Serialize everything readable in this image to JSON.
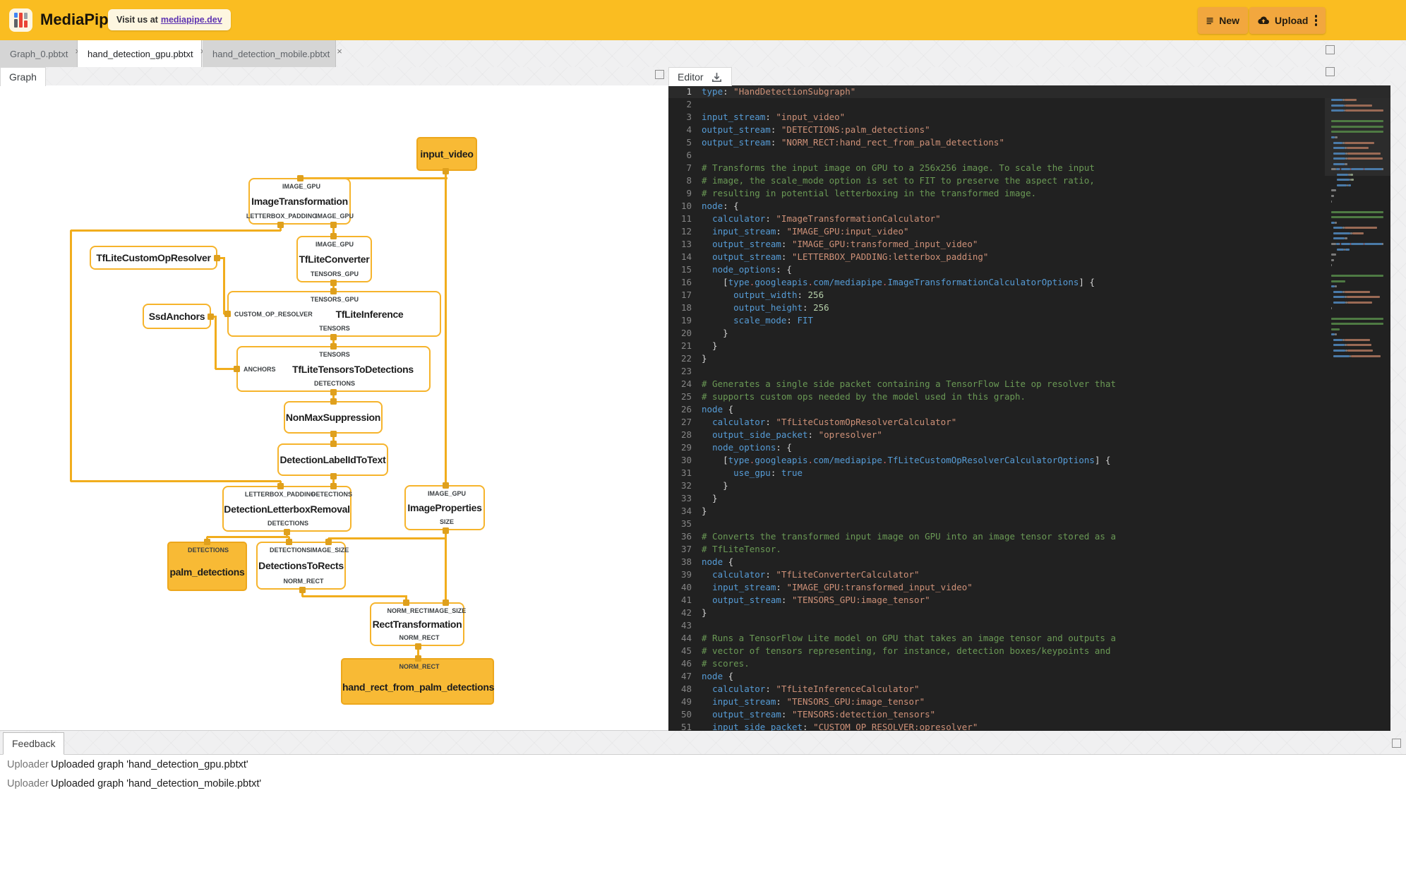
{
  "header": {
    "brand": "MediaPipe",
    "visit_prefix": "Visit us at",
    "visit_link": "mediapipe.dev",
    "new_label": "New",
    "upload_label": "Upload"
  },
  "colors": {
    "header_bg": "#fabd21",
    "header_button_bg": "#f2a73e",
    "edge": "#f1ad1d",
    "node_border": "#f6b42c",
    "stream_fill": "#f8ba35",
    "editor_bg": "#212121",
    "link": "#5e35b1"
  },
  "file_tabs": [
    {
      "label": "Graph_0.pbtxt",
      "active": false,
      "close": "×"
    },
    {
      "label": "hand_detection_gpu.pbtxt",
      "active": true,
      "close": "×"
    },
    {
      "label": "hand_detection_mobile.pbtxt",
      "active": false,
      "close": "×"
    }
  ],
  "panel_tabs": {
    "graph": "Graph",
    "editor": "Editor",
    "feedback": "Feedback"
  },
  "graph": {
    "nodes": [
      {
        "id": "input_video",
        "label": "input_video",
        "kind": "stream",
        "top_ports": [],
        "bottom_ports": [],
        "left_port": null
      },
      {
        "id": "ImageTransformation",
        "label": "ImageTransformation",
        "kind": "calc",
        "top_ports": [
          "IMAGE_GPU"
        ],
        "bottom_ports": [
          "LETTERBOX_PADDING",
          "IMAGE_GPU"
        ],
        "left_port": null
      },
      {
        "id": "TfLiteConverter",
        "label": "TfLiteConverter",
        "kind": "calc",
        "top_ports": [
          "IMAGE_GPU"
        ],
        "bottom_ports": [
          "TENSORS_GPU"
        ],
        "left_port": null
      },
      {
        "id": "TfLiteCustomOpResolver",
        "label": "TfLiteCustomOpResolver",
        "kind": "calc",
        "top_ports": [],
        "bottom_ports": [],
        "left_port": null
      },
      {
        "id": "SsdAnchors",
        "label": "SsdAnchors",
        "kind": "calc",
        "top_ports": [],
        "bottom_ports": [],
        "left_port": null
      },
      {
        "id": "TfLiteInference",
        "label": "TfLiteInference",
        "kind": "calc",
        "top_ports": [
          "TENSORS_GPU"
        ],
        "bottom_ports": [
          "TENSORS"
        ],
        "left_port": "CUSTOM_OP_RESOLVER"
      },
      {
        "id": "TfLiteTensorsToDetections",
        "label": "TfLiteTensorsToDetections",
        "kind": "calc",
        "top_ports": [
          "TENSORS"
        ],
        "bottom_ports": [
          "DETECTIONS"
        ],
        "left_port": "ANCHORS"
      },
      {
        "id": "NonMaxSuppression",
        "label": "NonMaxSuppression",
        "kind": "calc",
        "top_ports": [],
        "bottom_ports": [],
        "left_port": null
      },
      {
        "id": "DetectionLabelIdToText",
        "label": "DetectionLabelIdToText",
        "kind": "calc",
        "top_ports": [],
        "bottom_ports": [],
        "left_port": null
      },
      {
        "id": "DetectionLetterboxRemoval",
        "label": "DetectionLetterboxRemoval",
        "kind": "calc",
        "top_ports": [
          "LETTERBOX_PADDING",
          "DETECTIONS"
        ],
        "bottom_ports": [
          "DETECTIONS"
        ],
        "left_port": null
      },
      {
        "id": "ImageProperties",
        "label": "ImageProperties",
        "kind": "calc",
        "top_ports": [
          "IMAGE_GPU"
        ],
        "bottom_ports": [
          "SIZE"
        ],
        "left_port": null
      },
      {
        "id": "palm_detections",
        "label": "palm_detections",
        "kind": "stream",
        "top_ports": [
          "DETECTIONS"
        ],
        "bottom_ports": [],
        "left_port": null
      },
      {
        "id": "DetectionsToRects",
        "label": "DetectionsToRects",
        "kind": "calc",
        "top_ports": [
          "DETECTIONS",
          "IMAGE_SIZE"
        ],
        "bottom_ports": [
          "NORM_RECT"
        ],
        "left_port": null
      },
      {
        "id": "RectTransformation",
        "label": "RectTransformation",
        "kind": "calc",
        "top_ports": [
          "NORM_RECT",
          "IMAGE_SIZE"
        ],
        "bottom_ports": [
          "NORM_RECT"
        ],
        "left_port": null
      },
      {
        "id": "hand_rect_from_palm_detections",
        "label": "hand_rect_from_palm_detections",
        "kind": "stream",
        "top_ports": [
          "NORM_RECT"
        ],
        "bottom_ports": [],
        "left_port": null
      }
    ]
  },
  "editor": {
    "lines": [
      {
        "n": 1,
        "t": [
          [
            "k",
            "type"
          ],
          [
            "p",
            ": "
          ],
          [
            "s",
            "\"HandDetectionSubgraph\""
          ]
        ]
      },
      {
        "n": 2,
        "t": []
      },
      {
        "n": 3,
        "t": [
          [
            "k",
            "input_stream"
          ],
          [
            "p",
            ": "
          ],
          [
            "s",
            "\"input_video\""
          ]
        ]
      },
      {
        "n": 4,
        "t": [
          [
            "k",
            "output_stream"
          ],
          [
            "p",
            ": "
          ],
          [
            "s",
            "\"DETECTIONS:palm_detections\""
          ]
        ]
      },
      {
        "n": 5,
        "t": [
          [
            "k",
            "output_stream"
          ],
          [
            "p",
            ": "
          ],
          [
            "s",
            "\"NORM_RECT:hand_rect_from_palm_detections\""
          ]
        ]
      },
      {
        "n": 6,
        "t": []
      },
      {
        "n": 7,
        "t": [
          [
            "c",
            "# Transforms the input image on GPU to a 256x256 image. To scale the input"
          ]
        ]
      },
      {
        "n": 8,
        "t": [
          [
            "c",
            "# image, the scale_mode option is set to FIT to preserve the aspect ratio,"
          ]
        ]
      },
      {
        "n": 9,
        "t": [
          [
            "c",
            "# resulting in potential letterboxing in the transformed image."
          ]
        ]
      },
      {
        "n": 10,
        "t": [
          [
            "k",
            "node"
          ],
          [
            "p",
            ": {"
          ]
        ]
      },
      {
        "n": 11,
        "t": [
          [
            "p",
            "  "
          ],
          [
            "k",
            "calculator"
          ],
          [
            "p",
            ": "
          ],
          [
            "s",
            "\"ImageTransformationCalculator\""
          ]
        ]
      },
      {
        "n": 12,
        "t": [
          [
            "p",
            "  "
          ],
          [
            "k",
            "input_stream"
          ],
          [
            "p",
            ": "
          ],
          [
            "s",
            "\"IMAGE_GPU:input_video\""
          ]
        ]
      },
      {
        "n": 13,
        "t": [
          [
            "p",
            "  "
          ],
          [
            "k",
            "output_stream"
          ],
          [
            "p",
            ": "
          ],
          [
            "s",
            "\"IMAGE_GPU:transformed_input_video\""
          ]
        ]
      },
      {
        "n": 14,
        "t": [
          [
            "p",
            "  "
          ],
          [
            "k",
            "output_stream"
          ],
          [
            "p",
            ": "
          ],
          [
            "s",
            "\"LETTERBOX_PADDING:letterbox_padding\""
          ]
        ]
      },
      {
        "n": 15,
        "t": [
          [
            "p",
            "  "
          ],
          [
            "k",
            "node_options"
          ],
          [
            "p",
            ": {"
          ]
        ]
      },
      {
        "n": 16,
        "t": [
          [
            "p",
            "    ["
          ],
          [
            "k",
            "type"
          ],
          [
            "d",
            "."
          ],
          [
            "k",
            "googleapis"
          ],
          [
            "d",
            "."
          ],
          [
            "k",
            "com/mediapipe"
          ],
          [
            "d",
            "."
          ],
          [
            "k",
            "ImageTransformationCalculatorOptions"
          ],
          [
            "p",
            "] {"
          ]
        ]
      },
      {
        "n": 17,
        "t": [
          [
            "p",
            "      "
          ],
          [
            "k",
            "output_width"
          ],
          [
            "p",
            ": "
          ],
          [
            "n",
            "256"
          ]
        ]
      },
      {
        "n": 18,
        "t": [
          [
            "p",
            "      "
          ],
          [
            "k",
            "output_height"
          ],
          [
            "p",
            ": "
          ],
          [
            "n",
            "256"
          ]
        ]
      },
      {
        "n": 19,
        "t": [
          [
            "p",
            "      "
          ],
          [
            "k",
            "scale_mode"
          ],
          [
            "p",
            ": "
          ],
          [
            "k",
            "FIT"
          ]
        ]
      },
      {
        "n": 20,
        "t": [
          [
            "p",
            "    }"
          ]
        ]
      },
      {
        "n": 21,
        "t": [
          [
            "p",
            "  }"
          ]
        ]
      },
      {
        "n": 22,
        "t": [
          [
            "p",
            "}"
          ]
        ]
      },
      {
        "n": 23,
        "t": []
      },
      {
        "n": 24,
        "t": [
          [
            "c",
            "# Generates a single side packet containing a TensorFlow Lite op resolver that"
          ]
        ]
      },
      {
        "n": 25,
        "t": [
          [
            "c",
            "# supports custom ops needed by the model used in this graph."
          ]
        ]
      },
      {
        "n": 26,
        "t": [
          [
            "k",
            "node"
          ],
          [
            "p",
            " {"
          ]
        ]
      },
      {
        "n": 27,
        "t": [
          [
            "p",
            "  "
          ],
          [
            "k",
            "calculator"
          ],
          [
            "p",
            ": "
          ],
          [
            "s",
            "\"TfLiteCustomOpResolverCalculator\""
          ]
        ]
      },
      {
        "n": 28,
        "t": [
          [
            "p",
            "  "
          ],
          [
            "k",
            "output_side_packet"
          ],
          [
            "p",
            ": "
          ],
          [
            "s",
            "\"opresolver\""
          ]
        ]
      },
      {
        "n": 29,
        "t": [
          [
            "p",
            "  "
          ],
          [
            "k",
            "node_options"
          ],
          [
            "p",
            ": {"
          ]
        ]
      },
      {
        "n": 30,
        "t": [
          [
            "p",
            "    ["
          ],
          [
            "k",
            "type"
          ],
          [
            "d",
            "."
          ],
          [
            "k",
            "googleapis"
          ],
          [
            "d",
            "."
          ],
          [
            "k",
            "com/mediapipe"
          ],
          [
            "d",
            "."
          ],
          [
            "k",
            "TfLiteCustomOpResolverCalculatorOptions"
          ],
          [
            "p",
            "] {"
          ]
        ]
      },
      {
        "n": 31,
        "t": [
          [
            "p",
            "      "
          ],
          [
            "k",
            "use_gpu"
          ],
          [
            "p",
            ": "
          ],
          [
            "k",
            "true"
          ]
        ]
      },
      {
        "n": 32,
        "t": [
          [
            "p",
            "    }"
          ]
        ]
      },
      {
        "n": 33,
        "t": [
          [
            "p",
            "  }"
          ]
        ]
      },
      {
        "n": 34,
        "t": [
          [
            "p",
            "}"
          ]
        ]
      },
      {
        "n": 35,
        "t": []
      },
      {
        "n": 36,
        "t": [
          [
            "c",
            "# Converts the transformed input image on GPU into an image tensor stored as a"
          ]
        ]
      },
      {
        "n": 37,
        "t": [
          [
            "c",
            "# TfLiteTensor."
          ]
        ]
      },
      {
        "n": 38,
        "t": [
          [
            "k",
            "node"
          ],
          [
            "p",
            " {"
          ]
        ]
      },
      {
        "n": 39,
        "t": [
          [
            "p",
            "  "
          ],
          [
            "k",
            "calculator"
          ],
          [
            "p",
            ": "
          ],
          [
            "s",
            "\"TfLiteConverterCalculator\""
          ]
        ]
      },
      {
        "n": 40,
        "t": [
          [
            "p",
            "  "
          ],
          [
            "k",
            "input_stream"
          ],
          [
            "p",
            ": "
          ],
          [
            "s",
            "\"IMAGE_GPU:transformed_input_video\""
          ]
        ]
      },
      {
        "n": 41,
        "t": [
          [
            "p",
            "  "
          ],
          [
            "k",
            "output_stream"
          ],
          [
            "p",
            ": "
          ],
          [
            "s",
            "\"TENSORS_GPU:image_tensor\""
          ]
        ]
      },
      {
        "n": 42,
        "t": [
          [
            "p",
            "}"
          ]
        ]
      },
      {
        "n": 43,
        "t": []
      },
      {
        "n": 44,
        "t": [
          [
            "c",
            "# Runs a TensorFlow Lite model on GPU that takes an image tensor and outputs a"
          ]
        ]
      },
      {
        "n": 45,
        "t": [
          [
            "c",
            "# vector of tensors representing, for instance, detection boxes/keypoints and"
          ]
        ]
      },
      {
        "n": 46,
        "t": [
          [
            "c",
            "# scores."
          ]
        ]
      },
      {
        "n": 47,
        "t": [
          [
            "k",
            "node"
          ],
          [
            "p",
            " {"
          ]
        ]
      },
      {
        "n": 48,
        "t": [
          [
            "p",
            "  "
          ],
          [
            "k",
            "calculator"
          ],
          [
            "p",
            ": "
          ],
          [
            "s",
            "\"TfLiteInferenceCalculator\""
          ]
        ]
      },
      {
        "n": 49,
        "t": [
          [
            "p",
            "  "
          ],
          [
            "k",
            "input_stream"
          ],
          [
            "p",
            ": "
          ],
          [
            "s",
            "\"TENSORS_GPU:image_tensor\""
          ]
        ]
      },
      {
        "n": 50,
        "t": [
          [
            "p",
            "  "
          ],
          [
            "k",
            "output_stream"
          ],
          [
            "p",
            ": "
          ],
          [
            "s",
            "\"TENSORS:detection_tensors\""
          ]
        ]
      },
      {
        "n": 51,
        "t": [
          [
            "p",
            "  "
          ],
          [
            "k",
            "input_side_packet"
          ],
          [
            "p",
            ": "
          ],
          [
            "s",
            "\"CUSTOM_OP_RESOLVER:opresolver\""
          ]
        ]
      }
    ]
  },
  "feedback": {
    "rows": [
      {
        "source": "Uploader",
        "message": "Uploaded graph 'hand_detection_gpu.pbtxt'"
      },
      {
        "source": "Uploader",
        "message": "Uploaded graph 'hand_detection_mobile.pbtxt'"
      }
    ]
  }
}
